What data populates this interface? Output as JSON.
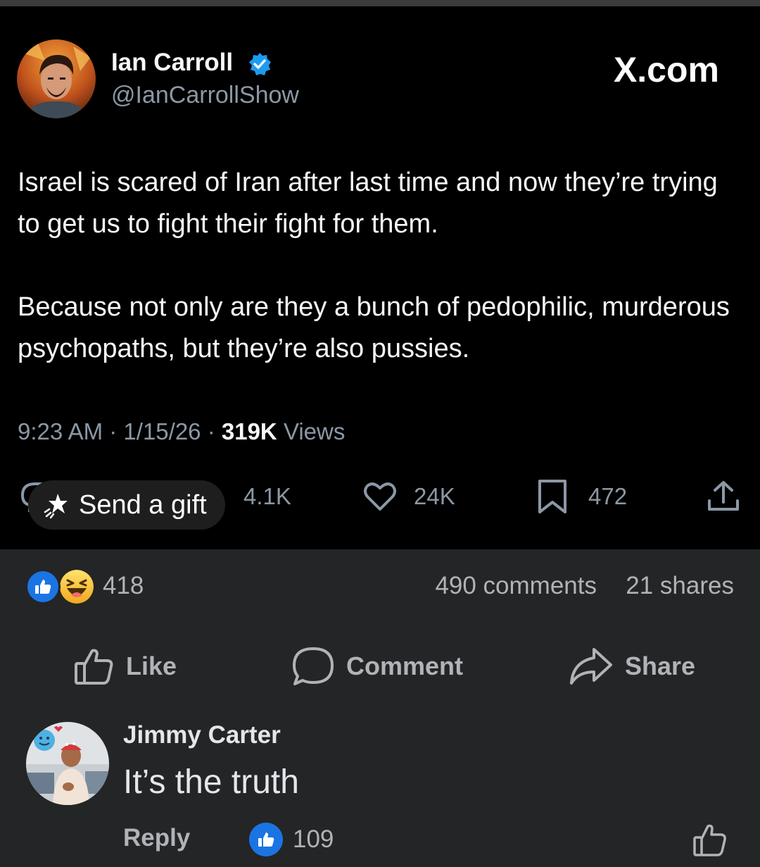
{
  "tweet": {
    "display_name": "Ian Carroll",
    "handle": "@IanCarrollShow",
    "source_label": "X.com",
    "paragraphs": [
      "Israel is scared of Iran after last time and now they’re trying to get us to fight their fight for them.",
      "Because not only are they a bunch of pedophilic, murderous psychopaths, but they’re also pussies."
    ],
    "time": "9:23 AM",
    "date": "1/15/26",
    "views_count": "319K",
    "views_label": "Views",
    "gift_label": "Send a gift",
    "retweets": "4.1K",
    "likes": "24K",
    "bookmarks": "472",
    "icons": [
      "verified-icon",
      "reply-icon",
      "gift-icon",
      "retweet-icon",
      "heart-icon",
      "bookmark-icon",
      "upload-icon"
    ],
    "colors": {
      "background": "#000000",
      "verified": "#1d9bf0",
      "secondary_text": "#8b98a5"
    }
  },
  "fb_post": {
    "reaction_count": "418",
    "comments_count": "490 comments",
    "shares_count": "21 shares",
    "reactions": [
      "like",
      "haha"
    ],
    "actions": {
      "like": "Like",
      "comment": "Comment",
      "share": "Share"
    },
    "colors": {
      "background": "#242526",
      "like_blue": "#1b74e4",
      "secondary_text": "#b0b3b8"
    }
  },
  "comment": {
    "author": "Jimmy Carter",
    "text": "It’s the truth",
    "reply_label": "Reply",
    "like_count": "109"
  }
}
